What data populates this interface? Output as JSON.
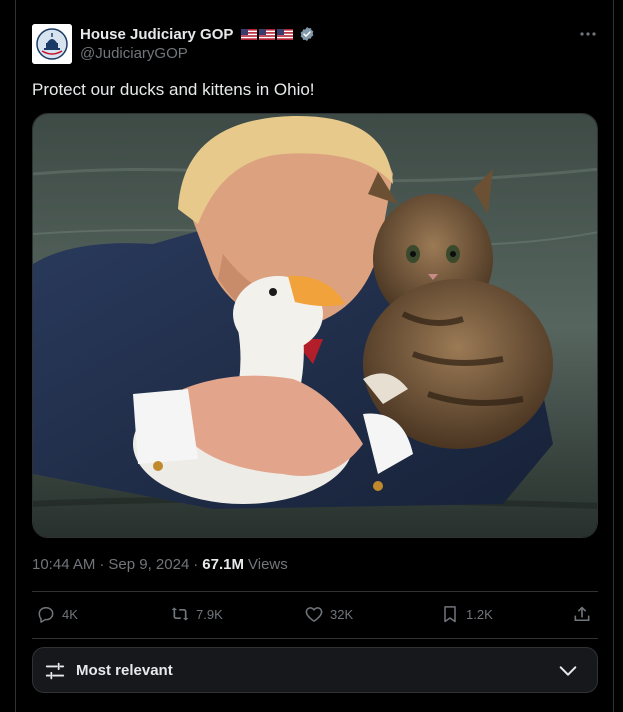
{
  "post": {
    "display_name": "House Judiciary GOP",
    "handle": "@JudiciaryGOP",
    "flags": [
      "us-flag-icon",
      "us-flag-icon",
      "us-flag-icon"
    ],
    "verified_icon": "verified-badge-icon",
    "more_icon": "more-options-icon",
    "text": "Protect our ducks and kittens in Ohio!",
    "media_icon": "photo-image",
    "time": "10:44 AM",
    "separator": "·",
    "date": "Sep 9, 2024",
    "views_count": "67.1M",
    "views_label": "Views"
  },
  "actions": {
    "replies": {
      "icon": "reply-icon",
      "count": "4K"
    },
    "reposts": {
      "icon": "repost-icon",
      "count": "7.9K"
    },
    "likes": {
      "icon": "like-icon",
      "count": "32K"
    },
    "bookmarks": {
      "icon": "bookmark-icon",
      "count": "1.2K"
    },
    "share": {
      "icon": "share-icon"
    }
  },
  "sort": {
    "icon": "filter-sliders-icon",
    "label": "Most relevant",
    "chevron": "chevron-down-icon"
  },
  "colors": {
    "background": "#000000",
    "text": "#e7e9ea",
    "muted": "#71767b",
    "border": "#2f3336",
    "verified": "#829aab",
    "panel": "#16181c"
  }
}
